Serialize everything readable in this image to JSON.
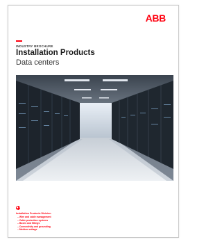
{
  "brand": {
    "logo_text": "ABB",
    "color": "#ff000f"
  },
  "header": {
    "eyebrow": "INDUSTRY BROCHURE",
    "title": "Installation Products",
    "subtitle": "Data centers"
  },
  "cover_image": {
    "description_icon": "data-center-photo"
  },
  "footer": {
    "icon": "plus-circle-icon",
    "heading": "Installation Products Division",
    "items": [
      "Wire and cable management",
      "Cable protection systems",
      "Boxes and fittings",
      "Connectivity and grounding",
      "Medium voltage"
    ]
  }
}
